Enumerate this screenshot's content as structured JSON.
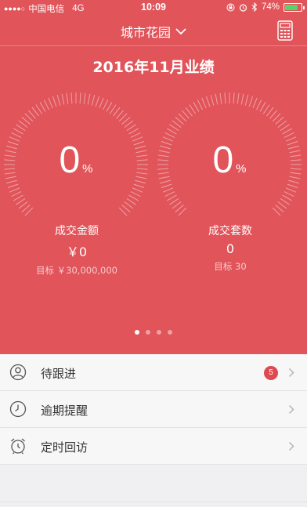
{
  "status_bar": {
    "signal_dots": "●●●●○",
    "carrier": "中国电信",
    "network": "4G",
    "time": "10:09",
    "battery_percent": "74%",
    "battery_level": 0.74,
    "icons": [
      "lock-rotation-icon",
      "alarm-icon",
      "bluetooth-icon",
      "battery-icon"
    ]
  },
  "navbar": {
    "title": "城市花园",
    "title_icon": "chevron-down-icon",
    "right_icon": "calculator-icon"
  },
  "performance": {
    "period_title": "2016年11月业绩",
    "gauges": [
      {
        "percent": "0",
        "unit": "%",
        "progress": 0,
        "label": "成交金额",
        "value": "￥0",
        "target": "目标 ￥30,000,000"
      },
      {
        "percent": "0",
        "unit": "%",
        "progress": 0,
        "label": "成交套数",
        "value": "0",
        "target": "目标 30"
      }
    ],
    "pager": {
      "count": 4,
      "active": 0
    }
  },
  "list": {
    "items": [
      {
        "label": "待跟进",
        "icon": "person-circle-icon",
        "badge": "5"
      },
      {
        "label": "逾期提醒",
        "icon": "clock-icon"
      },
      {
        "label": "定时回访",
        "icon": "alarm-clock-icon"
      }
    ]
  },
  "colors": {
    "hero_background": "#e0545a",
    "badge": "#dd4a50",
    "battery_fill": "#55d46b"
  }
}
